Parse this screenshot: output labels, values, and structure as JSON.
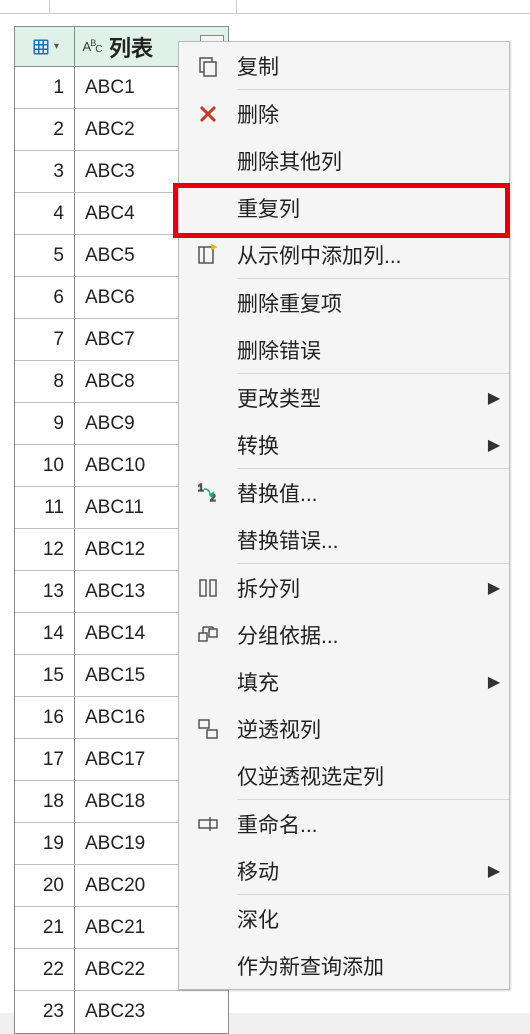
{
  "header": {
    "column_label": "列表"
  },
  "rows": [
    {
      "n": "1",
      "v": "ABC1"
    },
    {
      "n": "2",
      "v": "ABC2"
    },
    {
      "n": "3",
      "v": "ABC3"
    },
    {
      "n": "4",
      "v": "ABC4"
    },
    {
      "n": "5",
      "v": "ABC5"
    },
    {
      "n": "6",
      "v": "ABC6"
    },
    {
      "n": "7",
      "v": "ABC7"
    },
    {
      "n": "8",
      "v": "ABC8"
    },
    {
      "n": "9",
      "v": "ABC9"
    },
    {
      "n": "10",
      "v": "ABC10"
    },
    {
      "n": "11",
      "v": "ABC11"
    },
    {
      "n": "12",
      "v": "ABC12"
    },
    {
      "n": "13",
      "v": "ABC13"
    },
    {
      "n": "14",
      "v": "ABC14"
    },
    {
      "n": "15",
      "v": "ABC15"
    },
    {
      "n": "16",
      "v": "ABC16"
    },
    {
      "n": "17",
      "v": "ABC17"
    },
    {
      "n": "18",
      "v": "ABC18"
    },
    {
      "n": "19",
      "v": "ABC19"
    },
    {
      "n": "20",
      "v": "ABC20"
    },
    {
      "n": "21",
      "v": "ABC21"
    },
    {
      "n": "22",
      "v": "ABC22"
    },
    {
      "n": "23",
      "v": "ABC23"
    }
  ],
  "menu": {
    "copy": "复制",
    "remove": "删除",
    "remove_other": "删除其他列",
    "duplicate": "重复列",
    "add_from_examples": "从示例中添加列...",
    "remove_duplicates": "删除重复项",
    "remove_errors": "删除错误",
    "change_type": "更改类型",
    "transform": "转换",
    "replace_values": "替换值...",
    "replace_errors": "替换错误...",
    "split_column": "拆分列",
    "group_by": "分组依据...",
    "fill": "填充",
    "unpivot": "逆透视列",
    "unpivot_selected": "仅逆透视选定列",
    "rename": "重命名...",
    "move": "移动",
    "drill_down": "深化",
    "add_as_query": "作为新查询添加"
  }
}
